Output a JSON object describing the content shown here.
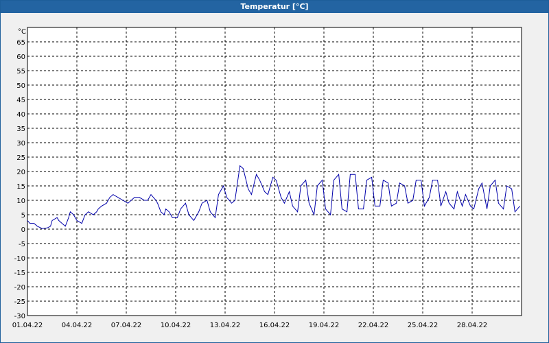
{
  "window": {
    "title": "Temperatur [°C]"
  },
  "colors": {
    "titlebar": "#2364a2",
    "line": "#0000aa",
    "grid": "#000000",
    "plot_bg": "#ffffff"
  },
  "chart_data": {
    "type": "line",
    "title": "Temperatur [°C]",
    "ylabel": "°C",
    "xlabel": "",
    "ylim": [
      -30,
      70
    ],
    "yticks": [
      65,
      60,
      55,
      50,
      45,
      40,
      35,
      30,
      25,
      20,
      15,
      10,
      5,
      0,
      -5,
      -10,
      -15,
      -20,
      -25,
      -30
    ],
    "xticks": [
      "01.04.22",
      "04.04.22",
      "07.04.22",
      "10.04.22",
      "13.04.22",
      "16.04.22",
      "19.04.22",
      "22.04.22",
      "25.04.22",
      "28.04.22"
    ],
    "xlim_days": [
      0,
      30
    ],
    "grid": true,
    "series": [
      {
        "x_days": [
          0,
          0.15,
          0.4,
          0.6,
          0.9,
          1.0,
          1.2,
          1.4,
          1.5,
          1.8,
          1.9,
          2.1,
          2.3,
          2.5,
          2.6,
          2.8,
          3.0,
          3.3,
          3.5,
          3.7,
          4.0,
          4.2,
          4.3,
          4.5,
          4.8,
          5.0,
          5.2,
          5.5,
          5.8,
          6.1,
          6.3,
          6.5,
          6.8,
          7.1,
          7.3,
          7.5,
          7.8,
          7.9,
          8.1,
          8.3,
          8.4,
          8.6,
          8.8,
          9.1,
          9.3,
          9.6,
          9.8,
          10.1,
          10.4,
          10.6,
          10.9,
          11.1,
          11.4,
          11.6,
          11.9,
          12.1,
          12.4,
          12.6,
          12.9,
          13.1,
          13.4,
          13.6,
          13.9,
          14.1,
          14.4,
          14.6,
          14.9,
          15.1,
          15.4,
          15.6,
          15.9,
          16.1,
          16.4,
          16.6,
          16.9,
          17.1,
          17.4,
          17.6,
          17.9,
          18.1,
          18.4,
          18.6,
          18.9,
          19.1,
          19.4,
          19.6,
          19.9,
          20.1,
          20.4,
          20.6,
          20.9,
          21.1,
          21.4,
          21.6,
          21.9,
          22.1,
          22.4,
          22.6,
          22.9,
          23.1,
          23.4,
          23.6,
          23.9,
          24.1,
          24.4,
          24.6,
          24.9,
          25.1,
          25.4,
          25.6,
          25.9,
          26.1,
          26.4,
          26.6,
          26.9,
          27.1,
          27.4,
          27.6,
          27.9,
          28.1,
          28.4,
          28.6,
          28.9,
          29.1,
          29.4,
          29.6,
          29.9
        ],
        "values": [
          3,
          2,
          2,
          1,
          0.2,
          0.3,
          0.4,
          1,
          3,
          4,
          3,
          2,
          1,
          4,
          6,
          5,
          3,
          2,
          5,
          6,
          5,
          6,
          7,
          8,
          9,
          11,
          12,
          11,
          10,
          9,
          10,
          11,
          11,
          10,
          10,
          12,
          10,
          9,
          6,
          5,
          7,
          6,
          4,
          4,
          7,
          9,
          5,
          3,
          6,
          9,
          10,
          6,
          4,
          12,
          15,
          11,
          9,
          10,
          22,
          21,
          14,
          12,
          19,
          17,
          13,
          12,
          18,
          17,
          11,
          9,
          13,
          8,
          6,
          15,
          17,
          9,
          5,
          15,
          17,
          7,
          5,
          17,
          19,
          7,
          6,
          19,
          19,
          7,
          7,
          17,
          18,
          8,
          8,
          17,
          16,
          8,
          9,
          16,
          15,
          9,
          10,
          17,
          17,
          8,
          11,
          17,
          17,
          8,
          13,
          9,
          7,
          13,
          8,
          12,
          8,
          7,
          14,
          16,
          7,
          15,
          17,
          9,
          7,
          15,
          14,
          6,
          8,
          13,
          10
        ]
      }
    ]
  }
}
